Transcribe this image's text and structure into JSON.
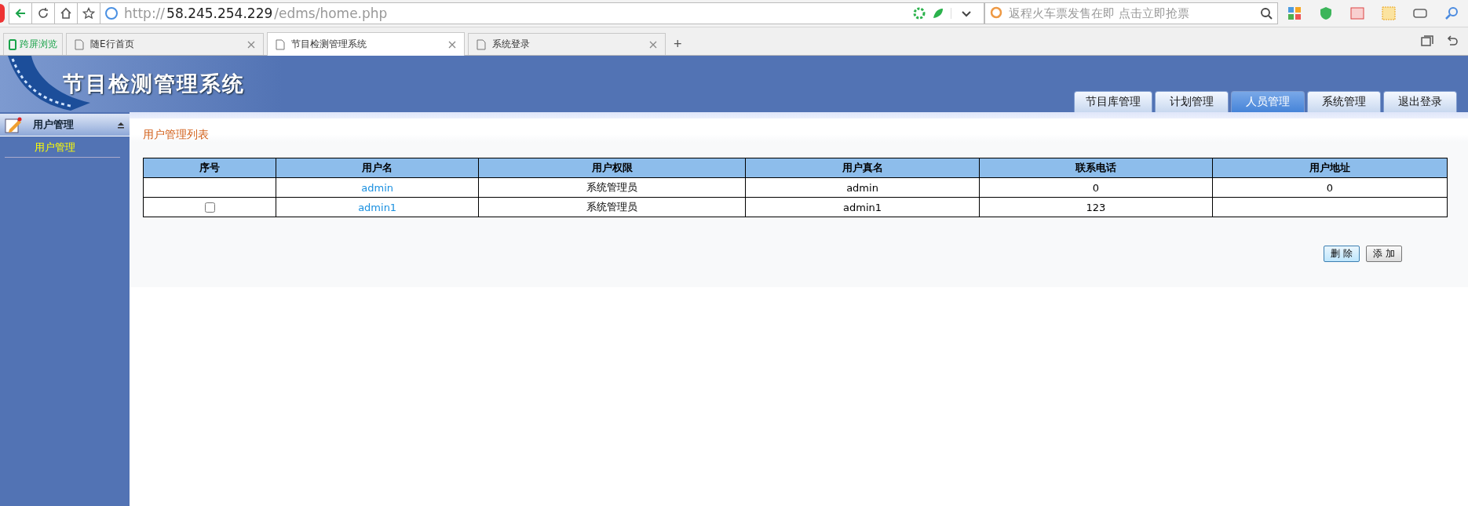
{
  "browser": {
    "url": {
      "scheme": "http://",
      "host": "58.245.254.229",
      "path": "/edms/home.php"
    },
    "search_placeholder": "返程火车票发售在即 点击立即抢票",
    "split_label": "跨屏浏览",
    "tabs": [
      {
        "title": "随E行首页",
        "selected": false
      },
      {
        "title": "节目检测管理系统",
        "selected": true
      },
      {
        "title": "系统登录",
        "selected": false
      }
    ],
    "new_tab": "+"
  },
  "header": {
    "logo_title": "节目检测管理系统",
    "nav": [
      {
        "label": "节目库管理",
        "selected": false
      },
      {
        "label": "计划管理",
        "selected": false
      },
      {
        "label": "人员管理",
        "selected": true
      },
      {
        "label": "系统管理",
        "selected": false
      },
      {
        "label": "退出登录",
        "selected": false
      }
    ]
  },
  "sidebar": {
    "section": "用户管理",
    "items": [
      {
        "label": "用户管理",
        "selected": true
      }
    ]
  },
  "content": {
    "title": "用户管理列表",
    "table": {
      "columns": [
        "序号",
        "用户名",
        "用户权限",
        "用户真名",
        "联系电话",
        "用户地址"
      ],
      "rows": [
        {
          "kind": "plain",
          "username": "admin",
          "role": "系统管理员",
          "real_name": "admin",
          "phone": "0",
          "address": "0"
        },
        {
          "kind": "checkbox",
          "checked": false,
          "username": "admin1",
          "role": "系统管理员",
          "real_name": "admin1",
          "phone": "123"
        }
      ]
    },
    "buttons": [
      {
        "label": "删 除",
        "selected": true
      },
      {
        "label": "添 加",
        "selected": false
      }
    ]
  }
}
